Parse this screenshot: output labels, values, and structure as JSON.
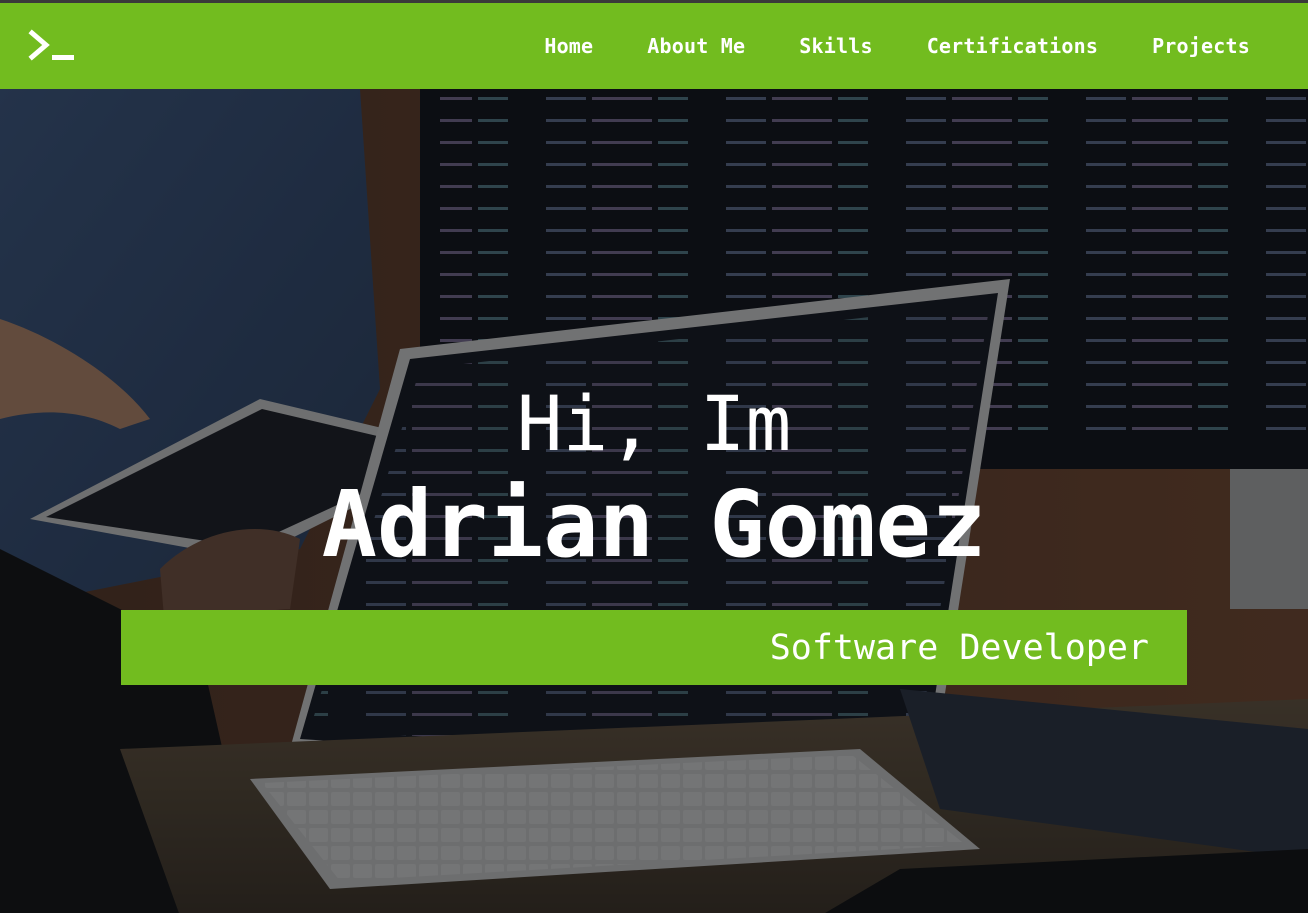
{
  "brand": {
    "logo_icon": "terminal-prompt-icon",
    "accent_color": "#72bc1f"
  },
  "nav": {
    "items": [
      {
        "label": "Home"
      },
      {
        "label": "About Me"
      },
      {
        "label": "Skills"
      },
      {
        "label": "Certifications"
      },
      {
        "label": "Projects"
      }
    ]
  },
  "hero": {
    "greeting": "Hi, Im",
    "name": "Adrian Gomez",
    "role": "Software Developer",
    "background_image": "developers-with-laptop-and-monitors-photo"
  }
}
